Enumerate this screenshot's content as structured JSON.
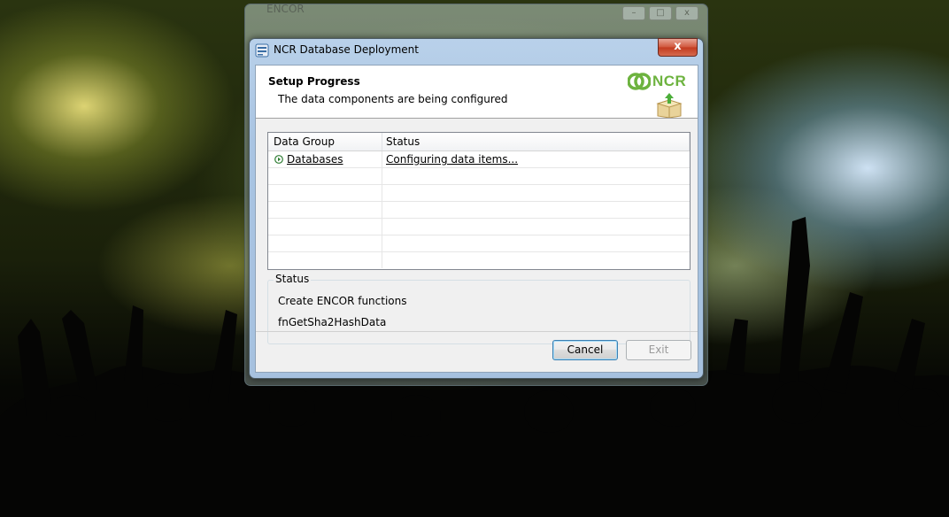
{
  "window": {
    "title": "NCR Database Deployment",
    "close_label": "x",
    "background_window_title": "ENCOR"
  },
  "header": {
    "title": "Setup Progress",
    "subtitle": "The data components are being configured",
    "logo_text": "NCR"
  },
  "list": {
    "columns": [
      "Data Group",
      "Status"
    ],
    "rows": [
      {
        "group": "Databases",
        "status": "Configuring data items...",
        "icon": "play-circle-icon"
      }
    ]
  },
  "status": {
    "label": "Status",
    "line1": "Create ENCOR functions",
    "line2": "fnGetSha2HashData"
  },
  "buttons": {
    "cancel": "Cancel",
    "exit": "Exit"
  },
  "colors": {
    "ncr_green": "#6db33f",
    "title_bar": "#b9d1ea",
    "close_red": "#c23a1f"
  }
}
